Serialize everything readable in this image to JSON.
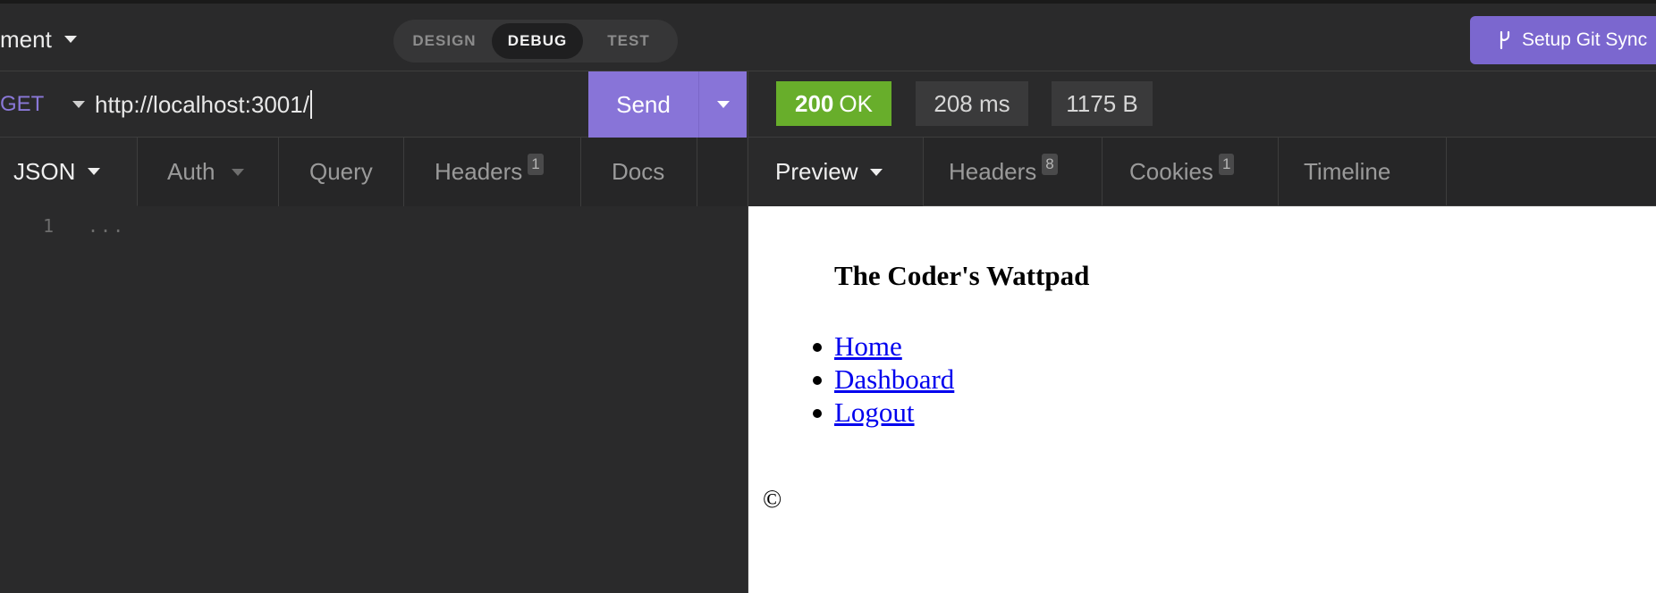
{
  "header": {
    "workspace_label": "ment",
    "modes": [
      "DESIGN",
      "DEBUG",
      "TEST"
    ],
    "active_mode": "DEBUG",
    "git_sync_label": "Setup Git Sync"
  },
  "request": {
    "method": "GET",
    "url": "http://localhost:3001/",
    "send_label": "Send",
    "tabs": [
      {
        "label": "JSON",
        "active": true
      },
      {
        "label": "Auth"
      },
      {
        "label": "Query"
      },
      {
        "label": "Headers",
        "badge": "1"
      },
      {
        "label": "Docs"
      }
    ],
    "body": {
      "line_number": "1",
      "content": "..."
    }
  },
  "response": {
    "status_code": "200",
    "status_text": "OK",
    "time": "208 ms",
    "size": "1175 B",
    "tabs": [
      {
        "label": "Preview",
        "active": true
      },
      {
        "label": "Headers",
        "badge": "8"
      },
      {
        "label": "Cookies",
        "badge": "1"
      },
      {
        "label": "Timeline"
      }
    ],
    "preview": {
      "title": "The Coder's Wattpad",
      "links": [
        "Home",
        "Dashboard",
        "Logout"
      ],
      "footer": "©"
    }
  },
  "colors": {
    "accent": "#8874d8",
    "status_ok": "#68ae2b",
    "link": "#0000ee",
    "background": "#2a2a2b"
  },
  "icons": [
    "chevron-down-icon",
    "git-branch-icon"
  ]
}
